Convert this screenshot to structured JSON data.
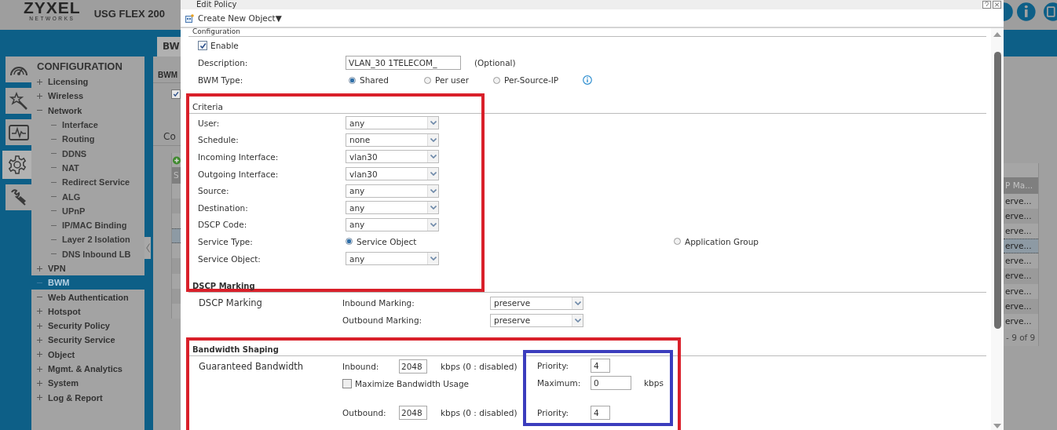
{
  "header": {
    "logo": "ZYXEL",
    "logo_sub": "NETWORKS",
    "product": "USG FLEX 200"
  },
  "icon_tabs": [
    {
      "kind": "dashboard",
      "selected": false
    },
    {
      "kind": "wizard",
      "selected": false
    },
    {
      "kind": "monitor",
      "selected": false
    },
    {
      "kind": "configuration",
      "selected": true
    },
    {
      "kind": "maintenance",
      "selected": false
    }
  ],
  "menu": {
    "title": "CONFIGURATION",
    "items": [
      {
        "kind": "group",
        "label": "Licensing",
        "expanded": false,
        "selected": false
      },
      {
        "kind": "group",
        "label": "Wireless",
        "expanded": false,
        "selected": false
      },
      {
        "kind": "group",
        "label": "Network",
        "expanded": true,
        "selected": false,
        "children": [
          {
            "label": "Interface",
            "selected": false
          },
          {
            "label": "Routing",
            "selected": false
          },
          {
            "label": "DDNS",
            "selected": false
          },
          {
            "label": "NAT",
            "selected": false
          },
          {
            "label": "Redirect Service",
            "selected": false
          },
          {
            "label": "ALG",
            "selected": false
          },
          {
            "label": "UPnP",
            "selected": false
          },
          {
            "label": "IP/MAC Binding",
            "selected": false
          },
          {
            "label": "Layer 2 Isolation",
            "selected": false
          },
          {
            "label": "DNS Inbound LB",
            "selected": false
          }
        ]
      },
      {
        "kind": "group",
        "label": "VPN",
        "expanded": false,
        "selected": false
      },
      {
        "kind": "leaf",
        "label": "BWM",
        "selected": true
      },
      {
        "kind": "leaf",
        "label": "Web Authentication",
        "selected": false
      },
      {
        "kind": "group",
        "label": "Hotspot",
        "expanded": false,
        "selected": false
      },
      {
        "kind": "group",
        "label": "Security Policy",
        "expanded": false,
        "selected": false
      },
      {
        "kind": "group",
        "label": "Security Service",
        "expanded": false,
        "selected": false
      },
      {
        "kind": "group",
        "label": "Object",
        "expanded": false,
        "selected": false
      },
      {
        "kind": "group",
        "label": "Mgmt. & Analytics",
        "expanded": false,
        "selected": false
      },
      {
        "kind": "group",
        "label": "System",
        "expanded": false,
        "selected": false
      },
      {
        "kind": "group",
        "label": "Log & Report",
        "expanded": false,
        "selected": false
      }
    ]
  },
  "background": {
    "tab": "BW",
    "section_1": "BWM",
    "section_1_checked": true,
    "section_2": "Co",
    "column_1": "S",
    "column_last": "P Ma...",
    "rows": [
      {
        "cell": "erve...",
        "selected": false
      },
      {
        "cell": "erve...",
        "selected": false
      },
      {
        "cell": "erve...",
        "selected": false
      },
      {
        "cell": "erve...",
        "selected": true
      },
      {
        "cell": "erve...",
        "selected": false
      },
      {
        "cell": "erve...",
        "selected": false
      },
      {
        "cell": "erve...",
        "selected": false
      },
      {
        "cell": "erve...",
        "selected": false
      },
      {
        "cell": "erve...",
        "selected": false
      }
    ],
    "pager": "- 9 of 9"
  },
  "dialog": {
    "title": "Edit Policy",
    "toolbar": "Create New Object▼"
  },
  "configuration": {
    "heading": "Configuration",
    "enable": {
      "label": "Enable",
      "checked": true
    },
    "description": {
      "label": "Description:",
      "value": "VLAN_30 1TELECOM_",
      "note": "(Optional)"
    },
    "bwm_type": {
      "label": "BWM Type:",
      "options": [
        {
          "label": "Shared",
          "selected": true
        },
        {
          "label": "Per user",
          "selected": false
        },
        {
          "label": "Per-Source-IP",
          "selected": false
        }
      ]
    }
  },
  "criteria": {
    "heading": "Criteria",
    "highlighted": true,
    "rows": [
      {
        "kind": "select",
        "label": "User:",
        "value": "any"
      },
      {
        "kind": "select",
        "label": "Schedule:",
        "value": "none"
      },
      {
        "kind": "select",
        "label": "Incoming Interface:",
        "value": "vlan30"
      },
      {
        "kind": "select",
        "label": "Outgoing Interface:",
        "value": "vlan30"
      },
      {
        "kind": "select",
        "label": "Source:",
        "value": "any"
      },
      {
        "kind": "select",
        "label": "Destination:",
        "value": "any"
      },
      {
        "kind": "select",
        "label": "DSCP Code:",
        "value": "any"
      },
      {
        "kind": "radio",
        "label": "Service Type:",
        "options": [
          {
            "label": "Service Object",
            "selected": true
          },
          {
            "label": "Application Group",
            "selected": false
          }
        ]
      },
      {
        "kind": "select",
        "label": "Service Object:",
        "value": "any"
      }
    ]
  },
  "dscp_marking": {
    "heading": "DSCP Marking",
    "label": "DSCP Marking",
    "rows": [
      {
        "label": "Inbound Marking:",
        "value": "preserve"
      },
      {
        "label": "Outbound Marking:",
        "value": "preserve"
      }
    ]
  },
  "bandwidth_shaping": {
    "heading": "Bandwidth Shaping",
    "highlighted": true,
    "label": "Guaranteed Bandwidth",
    "inbound": {
      "label": "Inbound:",
      "value": "2048",
      "unit": "kbps (0 : disabled)"
    },
    "maximize": {
      "label": "Maximize Bandwidth Usage",
      "checked": false
    },
    "outbound": {
      "label": "Outbound:",
      "value": "2048",
      "unit": "kbps (0 : disabled)"
    },
    "priority_box": {
      "highlighted": true,
      "inbound_priority": {
        "label": "Priority:",
        "value": "4"
      },
      "maximum": {
        "label": "Maximum:",
        "value": "0",
        "unit": "kbps"
      },
      "outbound_priority": {
        "label": "Priority:",
        "value": "4"
      }
    }
  }
}
